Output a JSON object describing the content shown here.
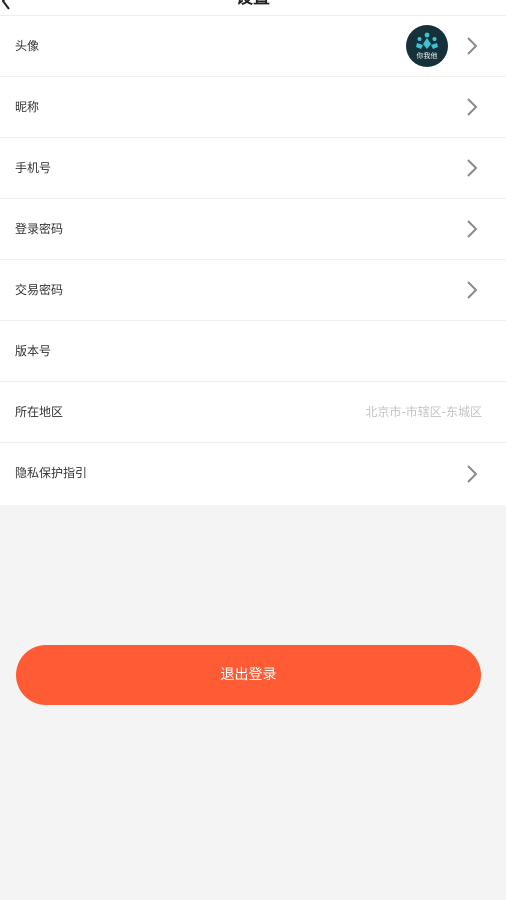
{
  "header": {
    "title": "设置",
    "back_icon": "chevron-left-icon"
  },
  "settings": {
    "avatar": {
      "label": "头像",
      "logo_text": "你我他"
    },
    "nickname": {
      "label": "昵称"
    },
    "phone": {
      "label": "手机号"
    },
    "login_password": {
      "label": "登录密码"
    },
    "trade_password": {
      "label": "交易密码"
    },
    "version": {
      "label": "版本号"
    },
    "region": {
      "label": "所在地区",
      "value": "北京市-市辖区-东城区"
    },
    "privacy": {
      "label": "隐私保护指引"
    }
  },
  "logout": {
    "label": "退出登录"
  },
  "colors": {
    "accent": "#ff5c35",
    "avatar_bg": "#17313b",
    "avatar_logo": "#3cc3d3",
    "background": "#f4f4f4",
    "chevron": "#8a8a8a"
  }
}
